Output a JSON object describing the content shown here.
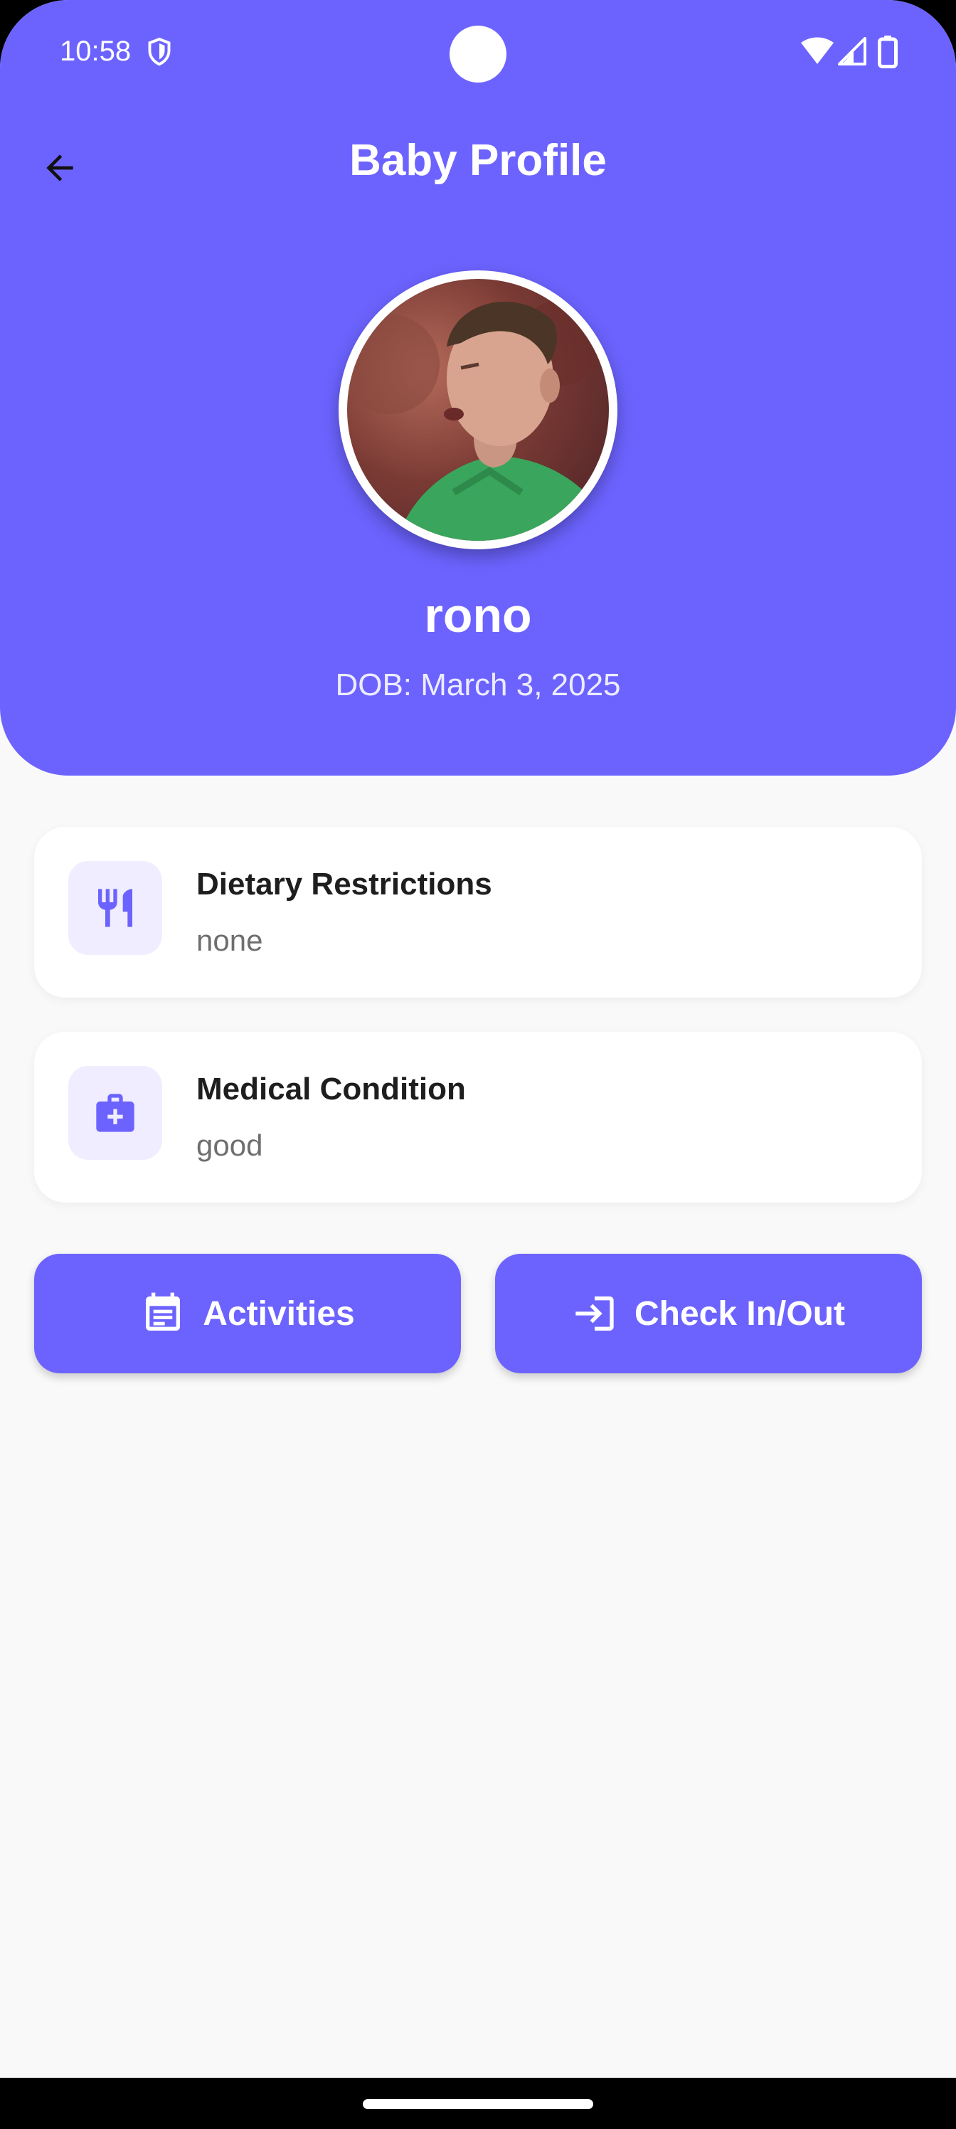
{
  "status_bar": {
    "time": "10:58"
  },
  "header": {
    "title": "Baby Profile"
  },
  "profile": {
    "name": "rono",
    "dob": "DOB: March 3, 2025"
  },
  "cards": [
    {
      "title": "Dietary Restrictions",
      "value": "none",
      "icon": "utensils-icon"
    },
    {
      "title": "Medical Condition",
      "value": "good",
      "icon": "medical-kit-icon"
    }
  ],
  "actions": {
    "activities_label": "Activities",
    "checkin_label": "Check In/Out"
  },
  "colors": {
    "primary": "#6c63ff",
    "icon_bg": "#efedff",
    "background": "#f9f9f9"
  }
}
